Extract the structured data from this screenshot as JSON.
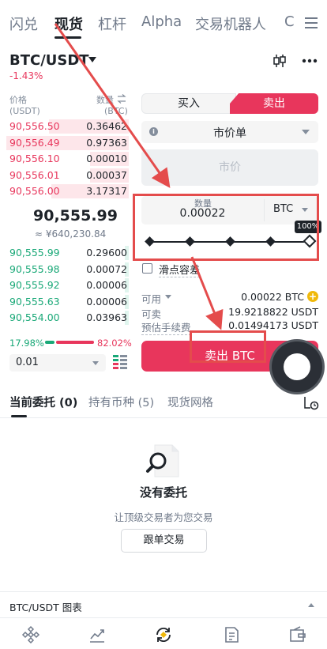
{
  "top_tabs": [
    "闪兑",
    "现货",
    "杠杆",
    "Alpha",
    "交易机器人",
    "C"
  ],
  "pair": {
    "symbol": "BTC/USDT",
    "change": "-1.43%"
  },
  "orderbook": {
    "price_header": "价格",
    "price_unit": "(USDT)",
    "qty_header": "数量",
    "qty_unit": "(BTC)",
    "asks": [
      {
        "price": "90,556.50",
        "qty": "0.36462",
        "depth": 0.62
      },
      {
        "price": "90,556.49",
        "qty": "0.97363",
        "depth": 0.95
      },
      {
        "price": "90,556.10",
        "qty": "0.00010",
        "depth": 0.3
      },
      {
        "price": "90,556.01",
        "qty": "0.00037",
        "depth": 0.3
      },
      {
        "price": "90,556.00",
        "qty": "3.17317",
        "depth": 0.6
      }
    ],
    "mid_price": "90,555.99",
    "mid_cny": "≈ ¥640,230.84",
    "bids": [
      {
        "price": "90,555.99",
        "qty": "0.29600",
        "depth": 0.03
      },
      {
        "price": "90,555.98",
        "qty": "0.00072",
        "depth": 0.03
      },
      {
        "price": "90,555.92",
        "qty": "0.00006",
        "depth": 0.03
      },
      {
        "price": "90,555.63",
        "qty": "0.00006",
        "depth": 0.03
      },
      {
        "price": "90,554.00",
        "qty": "0.03963",
        "depth": 0.03
      }
    ],
    "buy_ratio": "17.98%",
    "sell_ratio": "82.02%",
    "depth_value": "0.01"
  },
  "form": {
    "buy_label": "买入",
    "sell_label": "卖出",
    "order_type": "市价单",
    "market_price_placeholder": "市价",
    "qty_label": "数量",
    "qty_value": "0.00022",
    "qty_unit": "BTC",
    "slider_percent": "100%",
    "slider_value": 1.0,
    "slippage_label": "滑点容差",
    "available_label": "可用",
    "available_value": "0.00022 BTC",
    "sellable_label": "可卖",
    "sellable_value": "19.9218822 USDT",
    "fee_label": "预估手续费",
    "fee_value": "0.01494173 USDT",
    "submit_label": "卖出 BTC"
  },
  "bottom_tabs": [
    "当前委托 (0)",
    "持有币种 (5)",
    "现货网格"
  ],
  "empty": {
    "title": "没有委托",
    "subtitle": "让顶级交易者为您交易",
    "button": "跟单交易"
  },
  "chart_bar": {
    "title": "BTC/USDT 图表"
  },
  "colors": {
    "sell": "#e8365c",
    "buy": "#19a877",
    "annotation": "#e44c4c",
    "brand": "#f0b90b"
  },
  "icons": [
    "candlestick-icon",
    "more-icon",
    "info-icon",
    "plus-icon",
    "document-search-icon",
    "home-icon",
    "markets-icon",
    "trade-icon",
    "futures-icon",
    "wallet-icon"
  ]
}
